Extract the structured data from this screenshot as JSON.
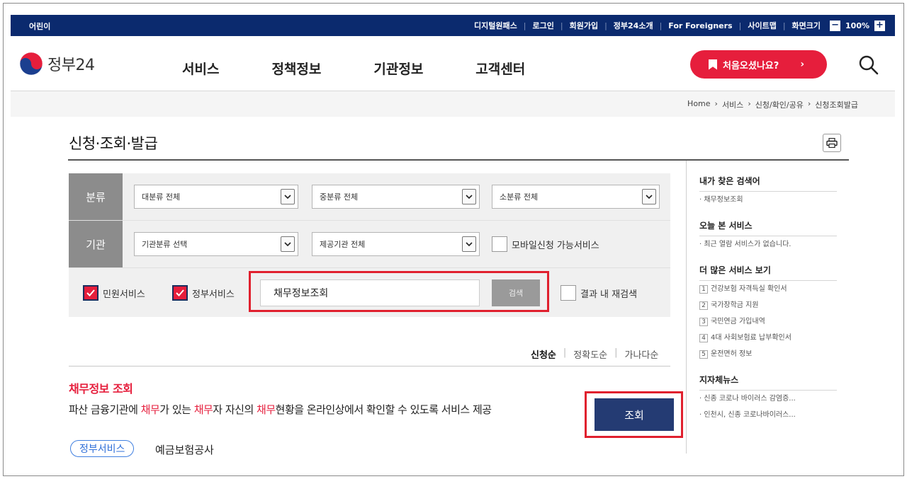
{
  "utility_bar": {
    "kids": "어린이",
    "links": [
      "디지털원패스",
      "로그인",
      "회원가입",
      "정부24소개",
      "For Foreigners",
      "사이트맵"
    ],
    "zoom_label": "화면크기",
    "zoom_minus": "−",
    "zoom_value": "100%",
    "zoom_plus": "+"
  },
  "header": {
    "logo_text": "정부24",
    "nav": [
      "서비스",
      "정책정보",
      "기관정보",
      "고객센터"
    ],
    "first_visit": "처음오셨나요?",
    "first_visit_arrow": "›",
    "colors": {
      "navy": "#0b2a6e",
      "red": "#e61e3c",
      "button_navy": "#243b73"
    }
  },
  "breadcrumb": [
    "Home",
    "›",
    "서비스",
    "›",
    "신청/확인/공유",
    "›",
    "신청조회발급"
  ],
  "page": {
    "title": "신청·조회·발급"
  },
  "filter": {
    "category_label": "분류",
    "org_label": "기관",
    "major_select": "대분류 전체",
    "middle_select": "중분류 전체",
    "minor_select": "소분류 전체",
    "org_class_select": "기관분류 선택",
    "provider_select": "제공기관 전체",
    "mobile_checkbox": "모바일신청 가능서비스",
    "civil_checkbox": "민원서비스",
    "gov_checkbox": "정부서비스",
    "search_value": "채무정보조회",
    "search_button": "검색",
    "research_checkbox": "결과 내 재검색"
  },
  "sort": [
    "신청순",
    "정확도순",
    "가나다순"
  ],
  "result": {
    "title": "채무정보 조회",
    "desc_parts": [
      "파산 금융기관에 ",
      "채무",
      "가 있는 ",
      "채무",
      "자 자신의 ",
      "채무",
      "현황을 온라인상에서 확인할 수 있도록 서비스 제공"
    ],
    "tag": "정부서비스",
    "org": "예금보험공사",
    "button": "조회"
  },
  "sidebar": {
    "my_search_title": "내가 찾은 검색어",
    "my_search_item": "· 채무정보조회",
    "today_title": "오늘 본 서비스",
    "today_item": "· 최근 열람 서비스가 없습니다.",
    "more_title": "더 많은 서비스 보기",
    "more_items": [
      {
        "num": "1",
        "label": "건강보험 자격득실 확인서"
      },
      {
        "num": "2",
        "label": "국가장학금 지원"
      },
      {
        "num": "3",
        "label": "국민연금 가입내역"
      },
      {
        "num": "4",
        "label": "4대 사회보험료 납부확인서"
      },
      {
        "num": "5",
        "label": "운전면허 정보"
      }
    ],
    "news_title": "지자체뉴스",
    "news_items": [
      "· 신종 코로나 바이러스 감염증...",
      "· 인천시, 신종 코로나바이러스..."
    ]
  }
}
